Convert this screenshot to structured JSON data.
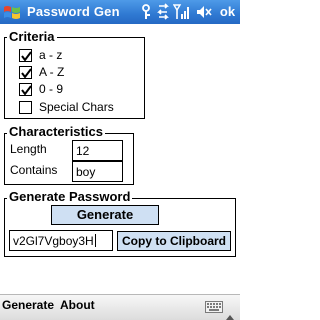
{
  "titlebar": {
    "title": "Password Gen",
    "ok_label": "ok"
  },
  "criteria": {
    "title": "Criteria",
    "options": [
      {
        "label": "a - z",
        "checked": true
      },
      {
        "label": "A - Z",
        "checked": true
      },
      {
        "label": "0 - 9",
        "checked": true
      },
      {
        "label": "Special Chars",
        "checked": false
      }
    ]
  },
  "characteristics": {
    "title": "Characteristics",
    "length_label": "Length",
    "length_value": "12",
    "contains_label": "Contains",
    "contains_value": "boy"
  },
  "generate": {
    "title": "Generate Password",
    "button_label": "Generate",
    "password_value": "v2Gl7Vgboy3H",
    "copy_label": "Copy to Clipboard"
  },
  "menubar": {
    "left_label": "Generate",
    "right_label": "About"
  },
  "icons": {
    "start": "windows-flag-icon",
    "connectivity": "connectivity-icon",
    "sync": "sync-arrows-icon",
    "signal": "signal-strength-icon",
    "volume": "volume-icon",
    "keyboard": "keyboard-icon"
  },
  "colors": {
    "titlebar": "#2f79d2",
    "button_fill": "#cfe0f3",
    "menubar": "#dcdcdc"
  }
}
